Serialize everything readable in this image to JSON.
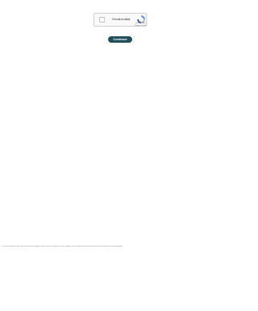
{
  "captcha": {
    "label": "I'm not a robot",
    "brand": "reCAPTCHA",
    "terms": "Privacy - Terms"
  },
  "continue_button": {
    "label": "Continue"
  },
  "footer": {
    "note": "This site is protected by reCAPTCHA and the Google Privacy Policy and Terms of Service apply. Please complete the verification above to continue to the requested page."
  },
  "colors": {
    "button_bg": "#20505a",
    "recaptcha_blue": "#1c3aa9",
    "recaptcha_light": "#4285f4",
    "recaptcha_gray": "#ababab"
  }
}
